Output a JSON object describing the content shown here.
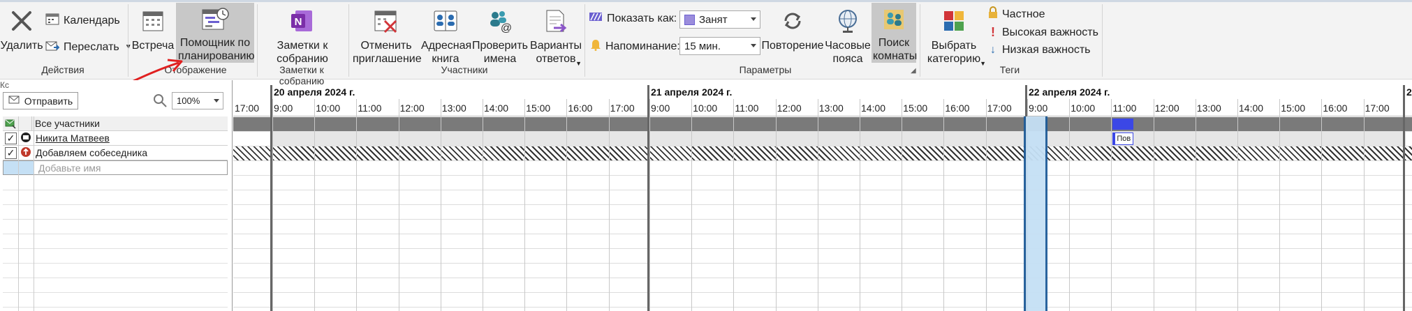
{
  "ribbon": {
    "actions": {
      "delete": "Удалить",
      "calendar": "Календарь",
      "forward": "Переслать",
      "group": "Действия"
    },
    "show": {
      "meeting": "Встреча",
      "scheduling_assistant": "Помощник по планированию",
      "group": "Отображение"
    },
    "notes": {
      "meeting_notes": "Заметки к собранию",
      "group": "Заметки к собранию"
    },
    "attendees": {
      "cancel_invite": "Отменить приглашение",
      "address_book": "Адресная книга",
      "check_names": "Проверить имена",
      "response_options": "Варианты ответов",
      "group": "Участники"
    },
    "options": {
      "show_as_label": "Показать как:",
      "show_as_value": "Занят",
      "reminder_label": "Напоминание:",
      "reminder_value": "15 мин.",
      "recurrence": "Повторение",
      "time_zones": "Часовые пояса",
      "room_finder": "Поиск комнаты",
      "group": "Параметры"
    },
    "tags": {
      "categorize": "Выбрать категорию",
      "private": "Частное",
      "high_importance": "Высокая важность",
      "low_importance": "Низкая важность",
      "group": "Теги"
    }
  },
  "scheduler": {
    "send_label": "Отправить",
    "cc_label": "Кс",
    "zoom_value": "100%",
    "all_attendees": "Все участники",
    "attendees": [
      "Никита Матвеев",
      "Добавляем собеседника"
    ],
    "add_name_placeholder": "Добавьте имя",
    "days": [
      "20 апреля 2024 г.",
      "21 апреля 2024 г.",
      "22 апреля 2024 г.",
      "2"
    ],
    "times_lead": "17:00",
    "times": [
      "9:00",
      "10:00",
      "11:00",
      "12:00",
      "13:00",
      "14:00",
      "15:00",
      "16:00",
      "17:00"
    ],
    "event_label": "Пов"
  },
  "colors": {
    "busy": "#3b47e6",
    "selected": "#c5e0f5",
    "selection_border": "#1f5c99",
    "header_bar": "#7a7a7a",
    "arrow": "#e02020",
    "shade": "#e6e6e6"
  }
}
